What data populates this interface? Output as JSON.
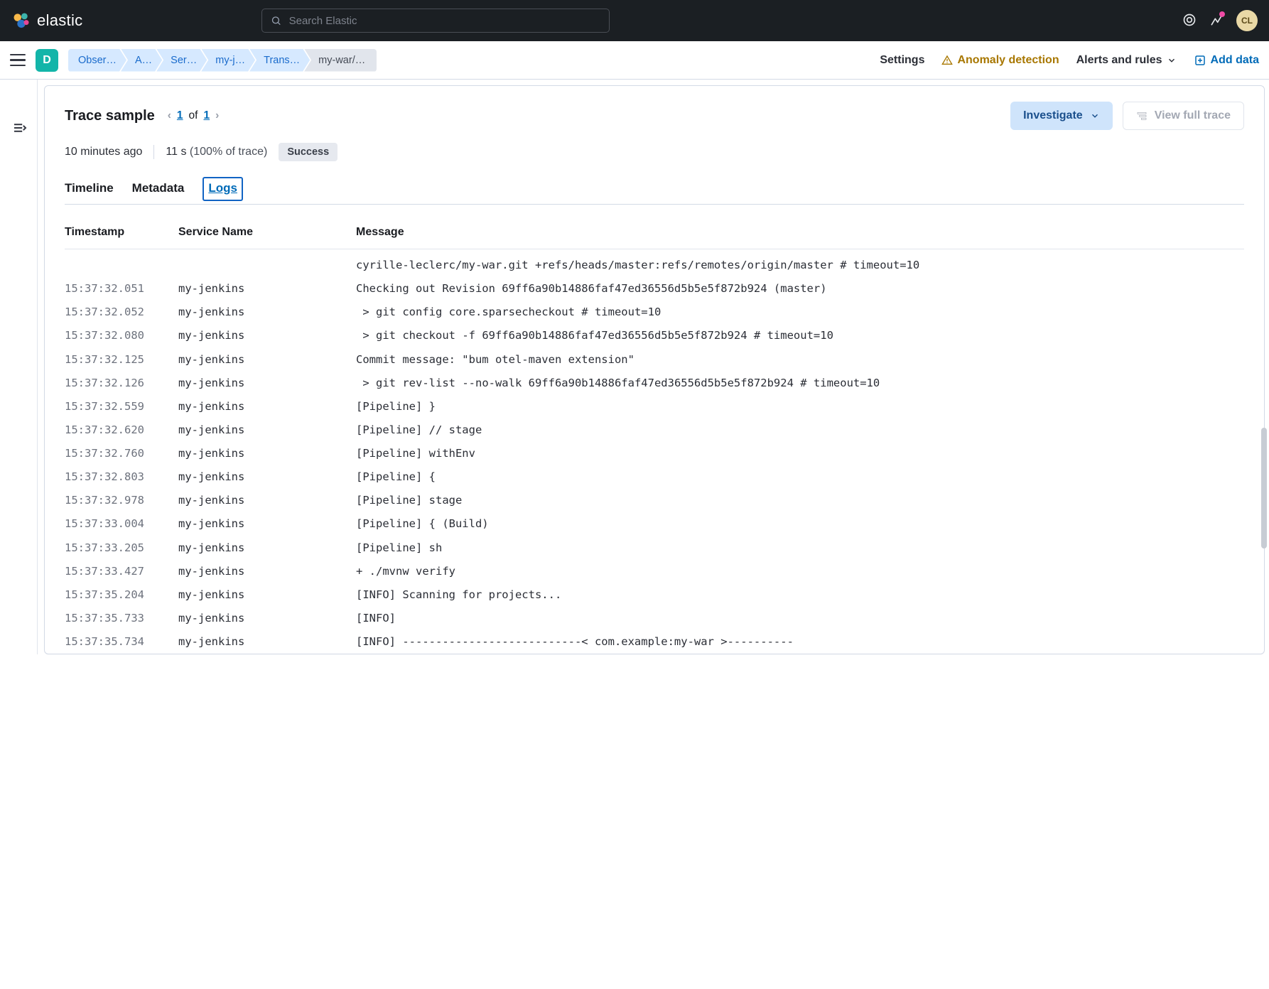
{
  "header": {
    "logo_text": "elastic",
    "search_placeholder": "Search Elastic",
    "avatar_initials": "CL"
  },
  "secbar": {
    "space_initial": "D",
    "crumbs": [
      "Obser…",
      "A…",
      "Ser…",
      "my-j…",
      "Trans…",
      "my-war/…"
    ],
    "settings": "Settings",
    "anomaly": "Anomaly detection",
    "alerts": "Alerts and rules",
    "add_data": "Add data"
  },
  "trace": {
    "title": "Trace sample",
    "pager_current": "1",
    "pager_of": "of",
    "pager_total": "1",
    "investigate": "Investigate",
    "view_full": "View full trace",
    "age": "10 minutes ago",
    "duration": "11 s",
    "pct": "(100% of trace)",
    "status": "Success"
  },
  "tabs": {
    "timeline": "Timeline",
    "metadata": "Metadata",
    "logs": "Logs"
  },
  "columns": {
    "ts": "Timestamp",
    "svc": "Service Name",
    "msg": "Message"
  },
  "logs": [
    {
      "ts": "",
      "svc": "",
      "msg": "cyrille-leclerc/my-war.git +refs/heads/master:refs/remotes/origin/master # timeout=10"
    },
    {
      "ts": "15:37:32.051",
      "svc": "my-jenkins",
      "msg": "Checking out Revision 69ff6a90b14886faf47ed36556d5b5e5f872b924 (master)"
    },
    {
      "ts": "15:37:32.052",
      "svc": "my-jenkins",
      "msg": " > git config core.sparsecheckout # timeout=10"
    },
    {
      "ts": "15:37:32.080",
      "svc": "my-jenkins",
      "msg": " > git checkout -f 69ff6a90b14886faf47ed36556d5b5e5f872b924 # timeout=10"
    },
    {
      "ts": "15:37:32.125",
      "svc": "my-jenkins",
      "msg": "Commit message: \"bum otel-maven extension\""
    },
    {
      "ts": "15:37:32.126",
      "svc": "my-jenkins",
      "msg": " > git rev-list --no-walk 69ff6a90b14886faf47ed36556d5b5e5f872b924 # timeout=10"
    },
    {
      "ts": "15:37:32.559",
      "svc": "my-jenkins",
      "msg": "[Pipeline] }"
    },
    {
      "ts": "15:37:32.620",
      "svc": "my-jenkins",
      "msg": "[Pipeline] // stage"
    },
    {
      "ts": "15:37:32.760",
      "svc": "my-jenkins",
      "msg": "[Pipeline] withEnv"
    },
    {
      "ts": "15:37:32.803",
      "svc": "my-jenkins",
      "msg": "[Pipeline] {"
    },
    {
      "ts": "15:37:32.978",
      "svc": "my-jenkins",
      "msg": "[Pipeline] stage"
    },
    {
      "ts": "15:37:33.004",
      "svc": "my-jenkins",
      "msg": "[Pipeline] { (Build)"
    },
    {
      "ts": "15:37:33.205",
      "svc": "my-jenkins",
      "msg": "[Pipeline] sh"
    },
    {
      "ts": "15:37:33.427",
      "svc": "my-jenkins",
      "msg": "+ ./mvnw verify"
    },
    {
      "ts": "15:37:35.204",
      "svc": "my-jenkins",
      "msg": "[INFO] Scanning for projects..."
    },
    {
      "ts": "15:37:35.733",
      "svc": "my-jenkins",
      "msg": "[INFO]"
    },
    {
      "ts": "15:37:35.734",
      "svc": "my-jenkins",
      "msg": "[INFO] ---------------------------< com.example:my-war >----------"
    }
  ]
}
